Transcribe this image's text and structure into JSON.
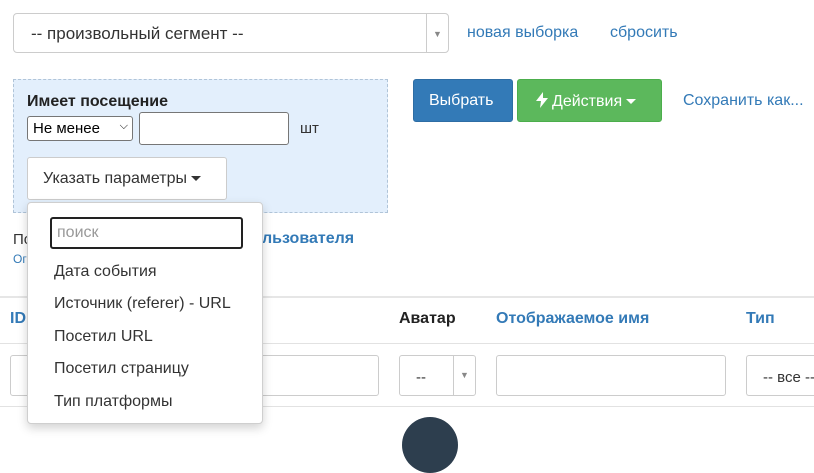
{
  "segment": {
    "value": "-- произвольный сегмент --"
  },
  "top_links": {
    "new_selection": "новая выборка",
    "reset": "сбросить"
  },
  "filter": {
    "title": "Имеет посещение",
    "comparison": "Не менее",
    "count_value": "",
    "unit": "шт",
    "params_button": "Указать параметры"
  },
  "actions": {
    "choose": "Выбрать",
    "actions_label": "Действия",
    "save_as": "Сохранить как..."
  },
  "behind": {
    "text_1": "По",
    "link_fragment": "льзователя",
    "text_2": "Ог"
  },
  "table": {
    "columns": {
      "id": "ID",
      "avatar": "Аватар",
      "display_name": "Отображаемое имя",
      "type": "Тип"
    },
    "avatar_filter": "--",
    "type_filter": "-- все --"
  },
  "dropdown": {
    "search_placeholder": "поиск",
    "items": [
      "Дата события",
      "Источник (referer) - URL",
      "Посетил URL",
      "Посетил страницу",
      "Тип платформы"
    ]
  },
  "colors": {
    "primary": "#337ab7",
    "success": "#5cb85c",
    "panel": "#e3effc"
  }
}
